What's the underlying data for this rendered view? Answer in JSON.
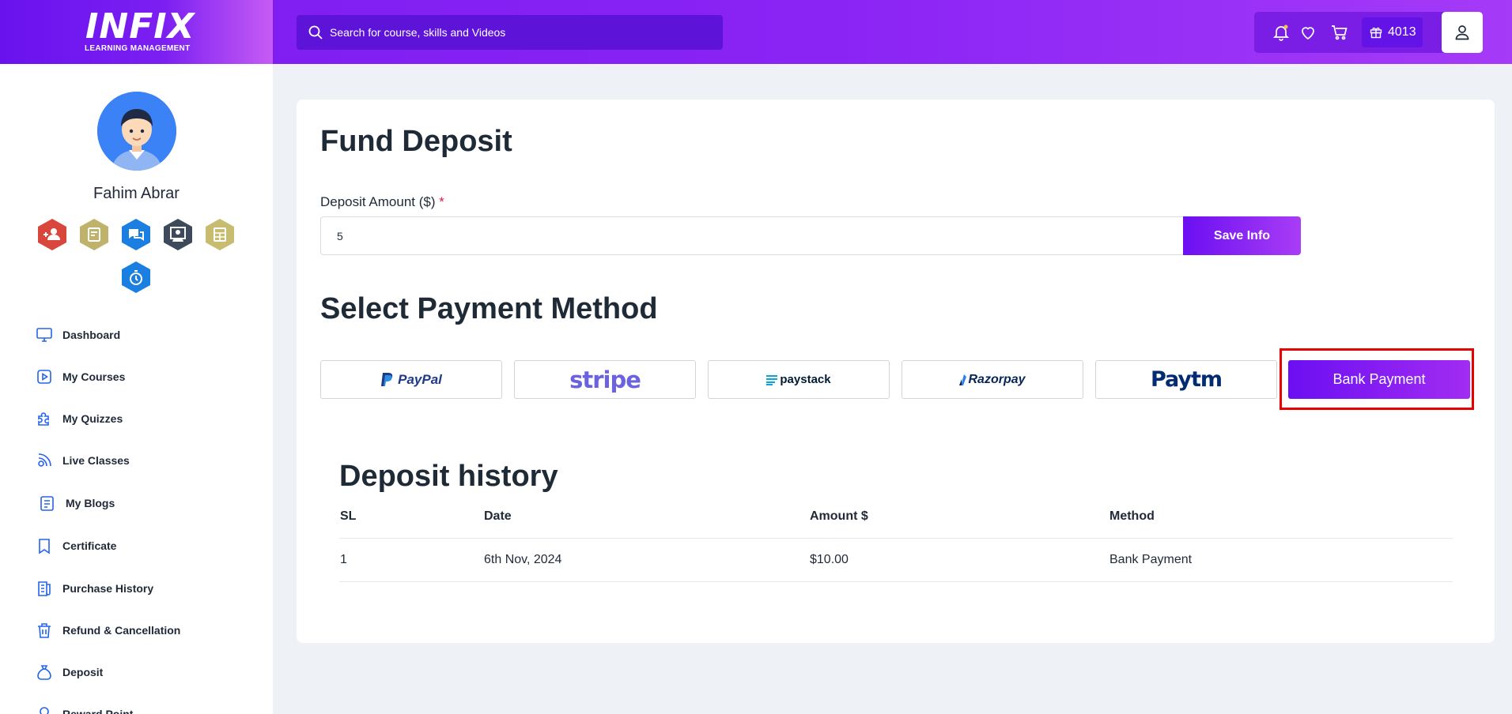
{
  "header": {
    "logo_text": "INFIX",
    "logo_subtitle": "LEARNING MANAGEMENT",
    "search_placeholder": "Search for course, skills and Videos",
    "icons": [
      "bell-icon",
      "heart-icon",
      "cart-icon",
      "gift-icon",
      "user-icon"
    ],
    "points": "4013"
  },
  "sidebar": {
    "user_name": "Fahim Abrar",
    "badges": [
      {
        "icon": "user-plus-icon",
        "color": "#d9463b"
      },
      {
        "icon": "document-icon",
        "color": "#bfb26b"
      },
      {
        "icon": "chat-icon",
        "color": "#1a7fe0"
      },
      {
        "icon": "teacher-icon",
        "color": "#3d4a5c"
      },
      {
        "icon": "grid-document-icon",
        "color": "#c8bc70"
      },
      {
        "icon": "stopwatch-icon",
        "color": "#1a7fe0"
      }
    ],
    "menu": [
      {
        "label": "Dashboard",
        "icon": "monitor-icon"
      },
      {
        "label": "My Courses",
        "icon": "play-square-icon"
      },
      {
        "label": "My Quizzes",
        "icon": "puzzle-icon"
      },
      {
        "label": "Live Classes",
        "icon": "broadcast-icon"
      },
      {
        "label": "My Blogs",
        "icon": "blog-icon"
      },
      {
        "label": "Certificate",
        "icon": "bookmark-icon"
      },
      {
        "label": "Purchase History",
        "icon": "receipt-icon"
      },
      {
        "label": "Refund & Cancellation",
        "icon": "trash-icon"
      },
      {
        "label": "Deposit",
        "icon": "money-bag-icon"
      },
      {
        "label": "Reward Point",
        "icon": "reward-icon"
      }
    ]
  },
  "main": {
    "title": "Fund Deposit",
    "deposit_label": "Deposit Amount ($)",
    "required_mark": "*",
    "deposit_value": "5",
    "save_button": "Save Info",
    "payment_title": "Select Payment Method",
    "payment_methods": [
      "PayPal",
      "stripe",
      "paystack",
      "Razorpay",
      "Paytm",
      "Bank Payment"
    ],
    "history_title": "Deposit history",
    "history_columns": [
      "SL",
      "Date",
      "Amount $",
      "Method"
    ],
    "history_rows": [
      {
        "sl": "1",
        "date": "6th Nov, 2024",
        "amount": "$10.00",
        "method": "Bank Payment"
      }
    ]
  },
  "colors": {
    "accent": "#7c1bf0",
    "accent_gradient_end": "#a53af7",
    "highlight_outline": "#e60000",
    "page_bg": "#eef2f7",
    "icon_blue": "#2563eb"
  }
}
